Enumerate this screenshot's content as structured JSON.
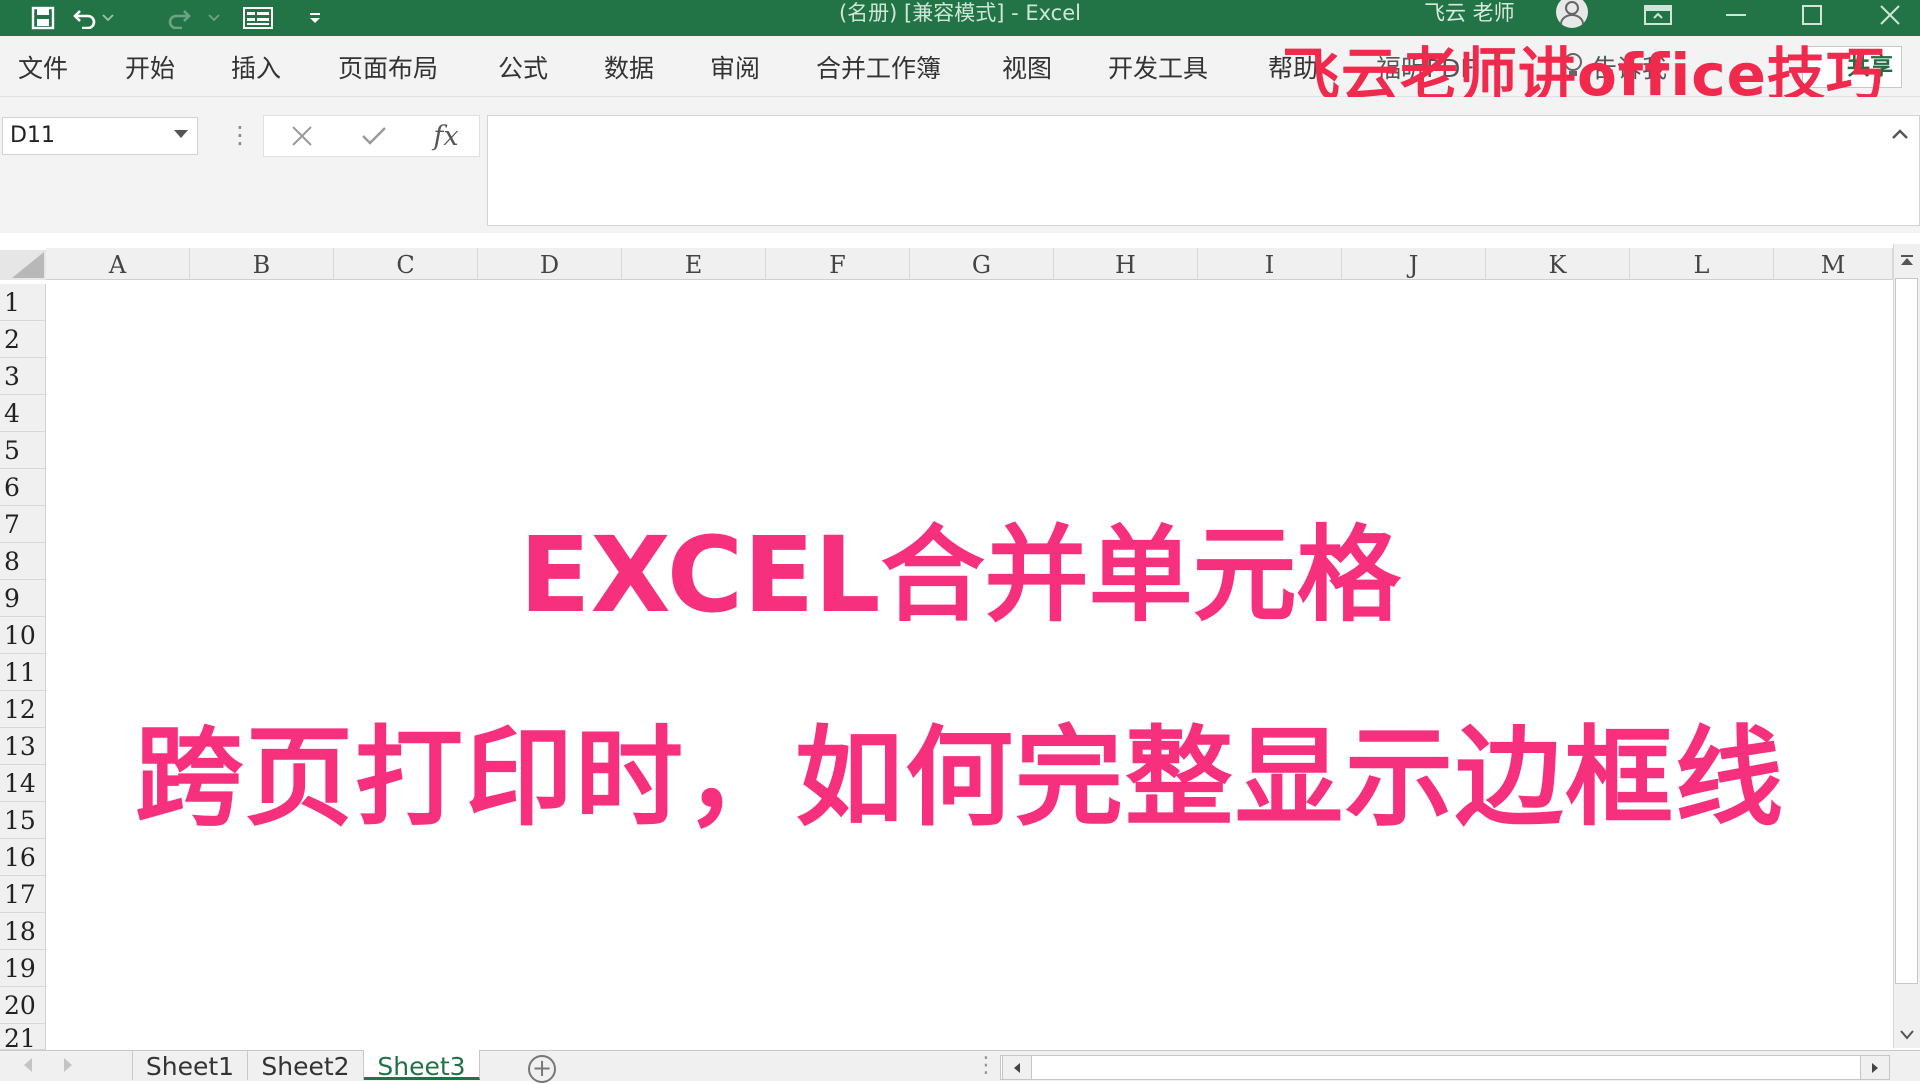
{
  "titlebar": {
    "title": "(名册)   [兼容模式]  -  Excel",
    "user": "飞云 老师"
  },
  "tabs": [
    "文件",
    "开始",
    "插入",
    "页面布局",
    "公式",
    "数据",
    "审阅",
    "合并工作簿",
    "视图",
    "开发工具",
    "帮助",
    "福昕PDF",
    "告诉我"
  ],
  "share_label": "共享",
  "brand": "飞云老师讲office技巧",
  "namebox": {
    "value": "D11"
  },
  "formula": {
    "fx": "fx"
  },
  "columns": [
    "A",
    "B",
    "C",
    "D",
    "E",
    "F",
    "G",
    "H",
    "I",
    "J",
    "K",
    "L",
    "M"
  ],
  "rows": [
    "1",
    "2",
    "3",
    "4",
    "5",
    "6",
    "7",
    "8",
    "9",
    "10",
    "11",
    "12",
    "13",
    "14",
    "15",
    "16",
    "17",
    "18",
    "19",
    "20",
    "21"
  ],
  "overlay": {
    "line1": "EXCEL合并单元格",
    "line2": "跨页打印时，如何完整显示边框线"
  },
  "sheets": [
    "Sheet1",
    "Sheet2",
    "Sheet3"
  ],
  "active_sheet": "Sheet3",
  "colors": {
    "titlebar": "#227447",
    "overlay_text": "#f7307e",
    "brand_text": "#f0294d",
    "active_sheet": "#217346"
  },
  "icons": [
    "save-icon",
    "undo-icon",
    "redo-icon",
    "form-icon",
    "customize-qat-icon",
    "avatar-icon",
    "ribbon-display-icon",
    "minimize-icon",
    "maximize-icon",
    "close-icon",
    "lightbulb-icon",
    "cancel-icon",
    "enter-icon",
    "add-sheet-icon"
  ]
}
